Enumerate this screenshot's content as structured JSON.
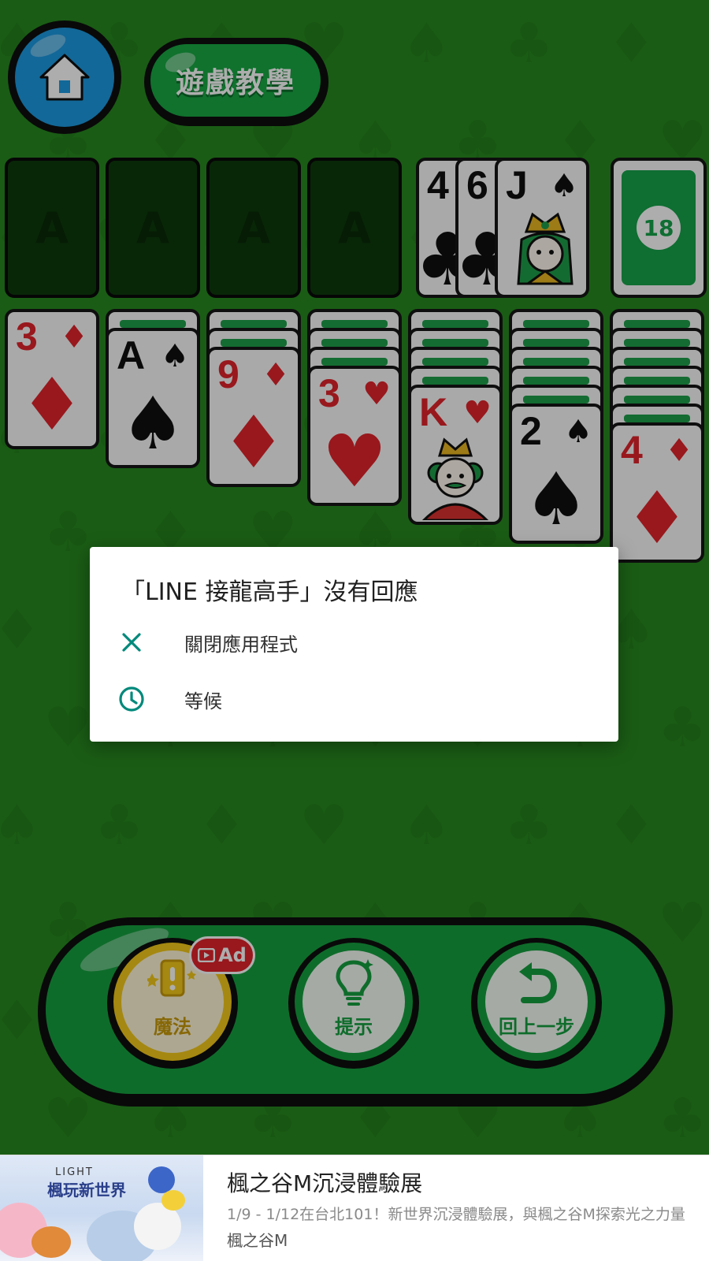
{
  "game": {
    "tutorial_label": "遊戲教學",
    "foundations": [
      "A",
      "A",
      "A",
      "A"
    ],
    "waste_cards": [
      {
        "rank": "4",
        "suit": "clubs",
        "color": "black"
      },
      {
        "rank": "6",
        "suit": "clubs",
        "color": "black"
      },
      {
        "rank": "J",
        "suit": "spades",
        "color": "black"
      }
    ],
    "stock_count": "18",
    "tableau": [
      {
        "facedown": 0,
        "rank": "3",
        "suit": "diamonds",
        "suit_char": "♦",
        "color": "red"
      },
      {
        "facedown": 1,
        "rank": "A",
        "suit": "spades",
        "suit_char": "♠",
        "color": "black"
      },
      {
        "facedown": 2,
        "rank": "9",
        "suit": "diamonds",
        "suit_char": "♦",
        "color": "red"
      },
      {
        "facedown": 3,
        "rank": "3",
        "suit": "hearts",
        "suit_char": "♥",
        "color": "red"
      },
      {
        "facedown": 4,
        "rank": "K",
        "suit": "hearts",
        "suit_char": "♥",
        "color": "red"
      },
      {
        "facedown": 5,
        "rank": "2",
        "suit": "spades",
        "suit_char": "♠",
        "color": "black"
      },
      {
        "facedown": 6,
        "rank": "4",
        "suit": "diamonds",
        "suit_char": "♦",
        "color": "red"
      }
    ],
    "buttons": {
      "magic_label": "魔法",
      "ad_badge": "Ad",
      "hint_label": "提示",
      "undo_label": "回上一步"
    }
  },
  "dialog": {
    "title": "「LINE 接龍高手」沒有回應",
    "close_app": "關閉應用程式",
    "wait": "等候",
    "accent_color": "#00897b"
  },
  "ad": {
    "image_brand": "LIGHT",
    "image_headline": "楓玩新世界",
    "title": "楓之谷M沉浸體驗展",
    "description": "1/9 - 1/12在台北101！新世界沉浸體驗展，與楓之谷M探索光之力量",
    "advertiser": "楓之谷M"
  },
  "colors": {
    "felt": "#27881f",
    "button_green": "#15a03f",
    "suit_red": "#e0242b",
    "home_blue": "#1b9ae0"
  }
}
